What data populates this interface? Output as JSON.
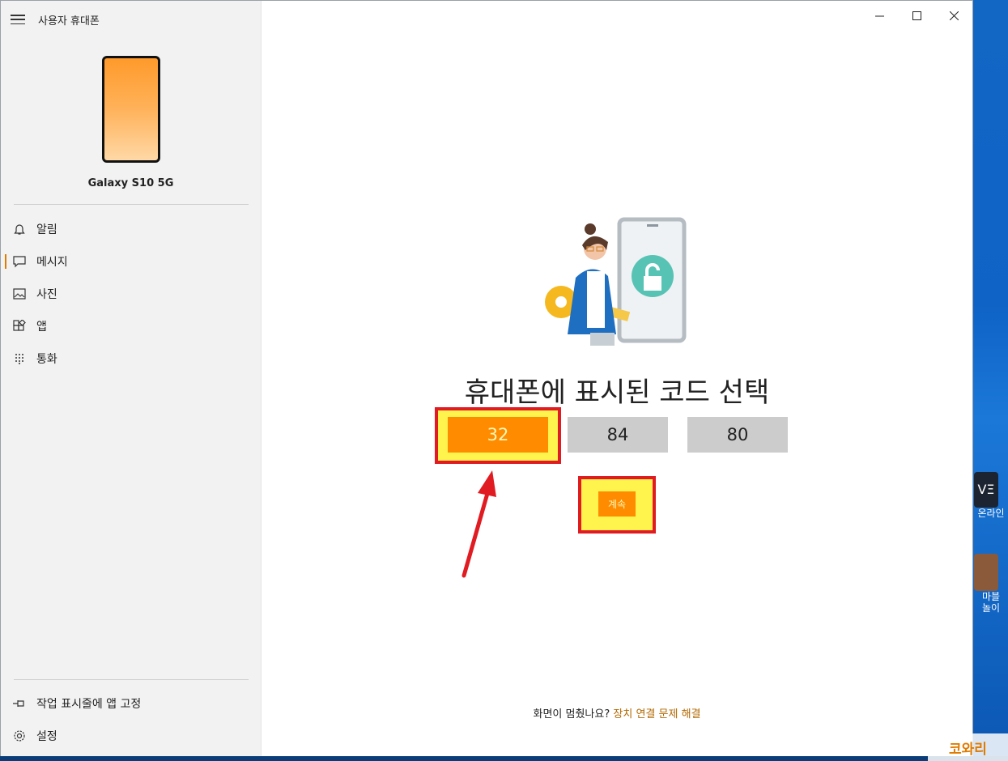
{
  "app": {
    "title": "사용자 휴대폰"
  },
  "device": {
    "name": "Galaxy S10 5G"
  },
  "sidebar": {
    "items": [
      {
        "label": "알림",
        "icon": "bell-icon"
      },
      {
        "label": "메시지",
        "icon": "message-icon",
        "active": true
      },
      {
        "label": "사진",
        "icon": "photo-icon"
      },
      {
        "label": "앱",
        "icon": "apps-icon"
      },
      {
        "label": "통화",
        "icon": "dialpad-icon"
      }
    ],
    "bottom": [
      {
        "label": "작업 표시줄에 앱 고정",
        "icon": "pin-icon"
      },
      {
        "label": "설정",
        "icon": "gear-icon"
      }
    ]
  },
  "main": {
    "heading": "휴대폰에 표시된 코드 선택",
    "codes": [
      "32",
      "84",
      "80"
    ],
    "selected_code": "32",
    "continue_label": "계속",
    "footer_question": "화면이 멈췄나요?",
    "footer_link": "장치 연결 문제 해결"
  },
  "desktop": {
    "icons": [
      {
        "label": "온라인"
      },
      {
        "label": "마블\n놀이"
      }
    ]
  },
  "watermark": {
    "text": "코와리"
  },
  "colors": {
    "accent": "#ff8c00",
    "highlight": "#fff34e",
    "annotation": "#e01b22"
  }
}
